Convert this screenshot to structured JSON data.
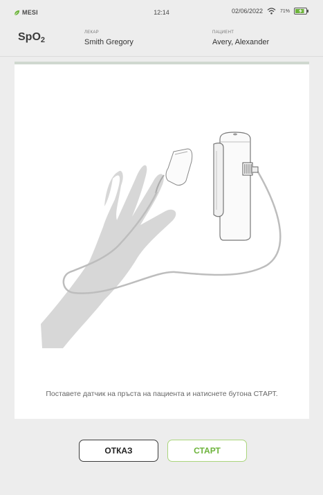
{
  "status_bar": {
    "brand": "MESI",
    "time": "12:14",
    "date": "02/06/2022",
    "battery_percent": "71%",
    "wifi_icon": "wifi-icon",
    "battery_icon": "battery-charging-icon"
  },
  "header": {
    "title_main": "SpO",
    "title_sub": "2",
    "doctor_label": "ЛЕКАР",
    "doctor_name": "Smith Gregory",
    "patient_label": "ПАЦИЕНТ",
    "patient_name": "Avery, Alexander"
  },
  "content": {
    "instruction": "Поставете датчик на пръста на пациента и натиснете бутона СТАРТ.",
    "illustration_icon": "finger-sensor-illustration"
  },
  "buttons": {
    "cancel": "ОТКАЗ",
    "start": "СТАРТ"
  },
  "colors": {
    "accent_green": "#6cb33a",
    "start_border": "#a9d57b",
    "background": "#ededed"
  }
}
